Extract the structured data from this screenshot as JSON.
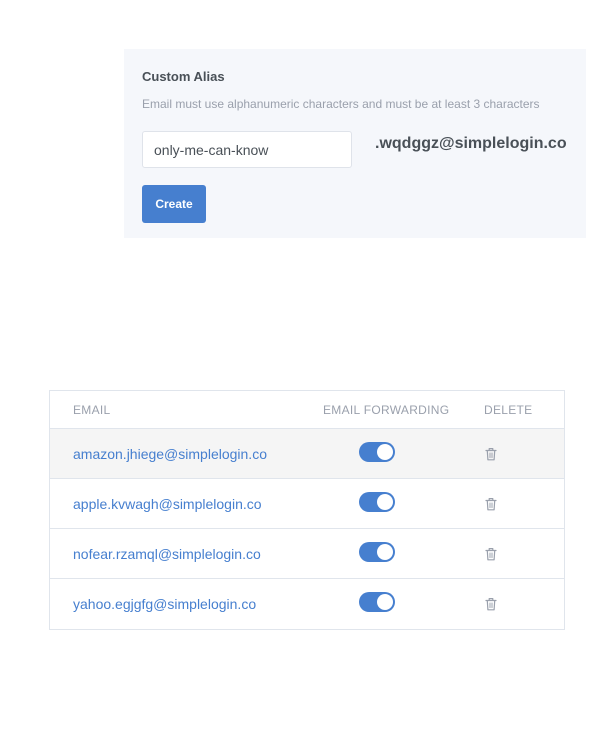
{
  "custom_alias": {
    "title": "Custom Alias",
    "hint": "Email must use alphanumeric characters and must be at least 3 characters",
    "input_value": "only-me-can-know",
    "suffix": ".wqdggz@simplelogin.co",
    "create_label": "Create"
  },
  "table": {
    "headers": {
      "email": "EMAIL",
      "forwarding": "EMAIL FORWARDING",
      "delete": "DELETE"
    },
    "rows": [
      {
        "email": "amazon.jhiege@simplelogin.co",
        "forwarding_enabled": true,
        "highlighted": true
      },
      {
        "email": "apple.kvwagh@simplelogin.co",
        "forwarding_enabled": true,
        "highlighted": false
      },
      {
        "email": "nofear.rzamql@simplelogin.co",
        "forwarding_enabled": true,
        "highlighted": false
      },
      {
        "email": "yahoo.egjgfg@simplelogin.co",
        "forwarding_enabled": true,
        "highlighted": false
      }
    ]
  },
  "colors": {
    "accent": "#467fcf",
    "card_background": "#f5f7fb",
    "highlight_row": "#f5f5f5",
    "muted_text": "#9aa0ac"
  },
  "icons": {
    "delete": "trash-icon"
  }
}
